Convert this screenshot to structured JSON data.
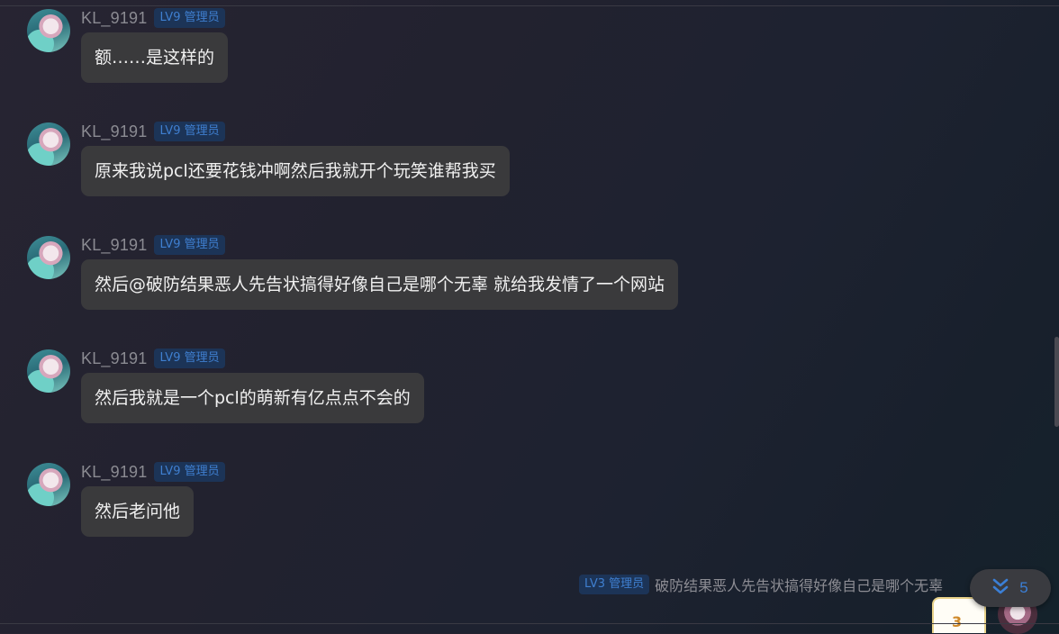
{
  "messages": [
    {
      "username": "KL_9191",
      "badge": "LV9 管理员",
      "text": "额……是这样的"
    },
    {
      "username": "KL_9191",
      "badge": "LV9 管理员",
      "text": "原来我说pcl还要花钱冲啊然后我就开个玩笑谁帮我买"
    },
    {
      "username": "KL_9191",
      "badge": "LV9 管理员",
      "text": "然后@破防结果恶人先告状搞得好像自己是哪个无辜 就给我发情了一个网站"
    },
    {
      "username": "KL_9191",
      "badge": "LV9 管理员",
      "text": "然后我就是一个pcl的萌新有亿点点不会的"
    },
    {
      "username": "KL_9191",
      "badge": "LV9 管理员",
      "text": "然后老问他"
    }
  ],
  "reply_preview": {
    "badge": "LV3 管理员",
    "text": "破防结果恶人先告状搞得好像自己是哪个无辜"
  },
  "jump_to_new": {
    "icon": "double-chevron-down-icon",
    "count": "5"
  },
  "corner_card_text": "3",
  "colors": {
    "bubble": "#3a3a3c",
    "badge_bg": "#1c3457",
    "badge_text": "#3f7fd0",
    "username": "#8b8b92"
  }
}
